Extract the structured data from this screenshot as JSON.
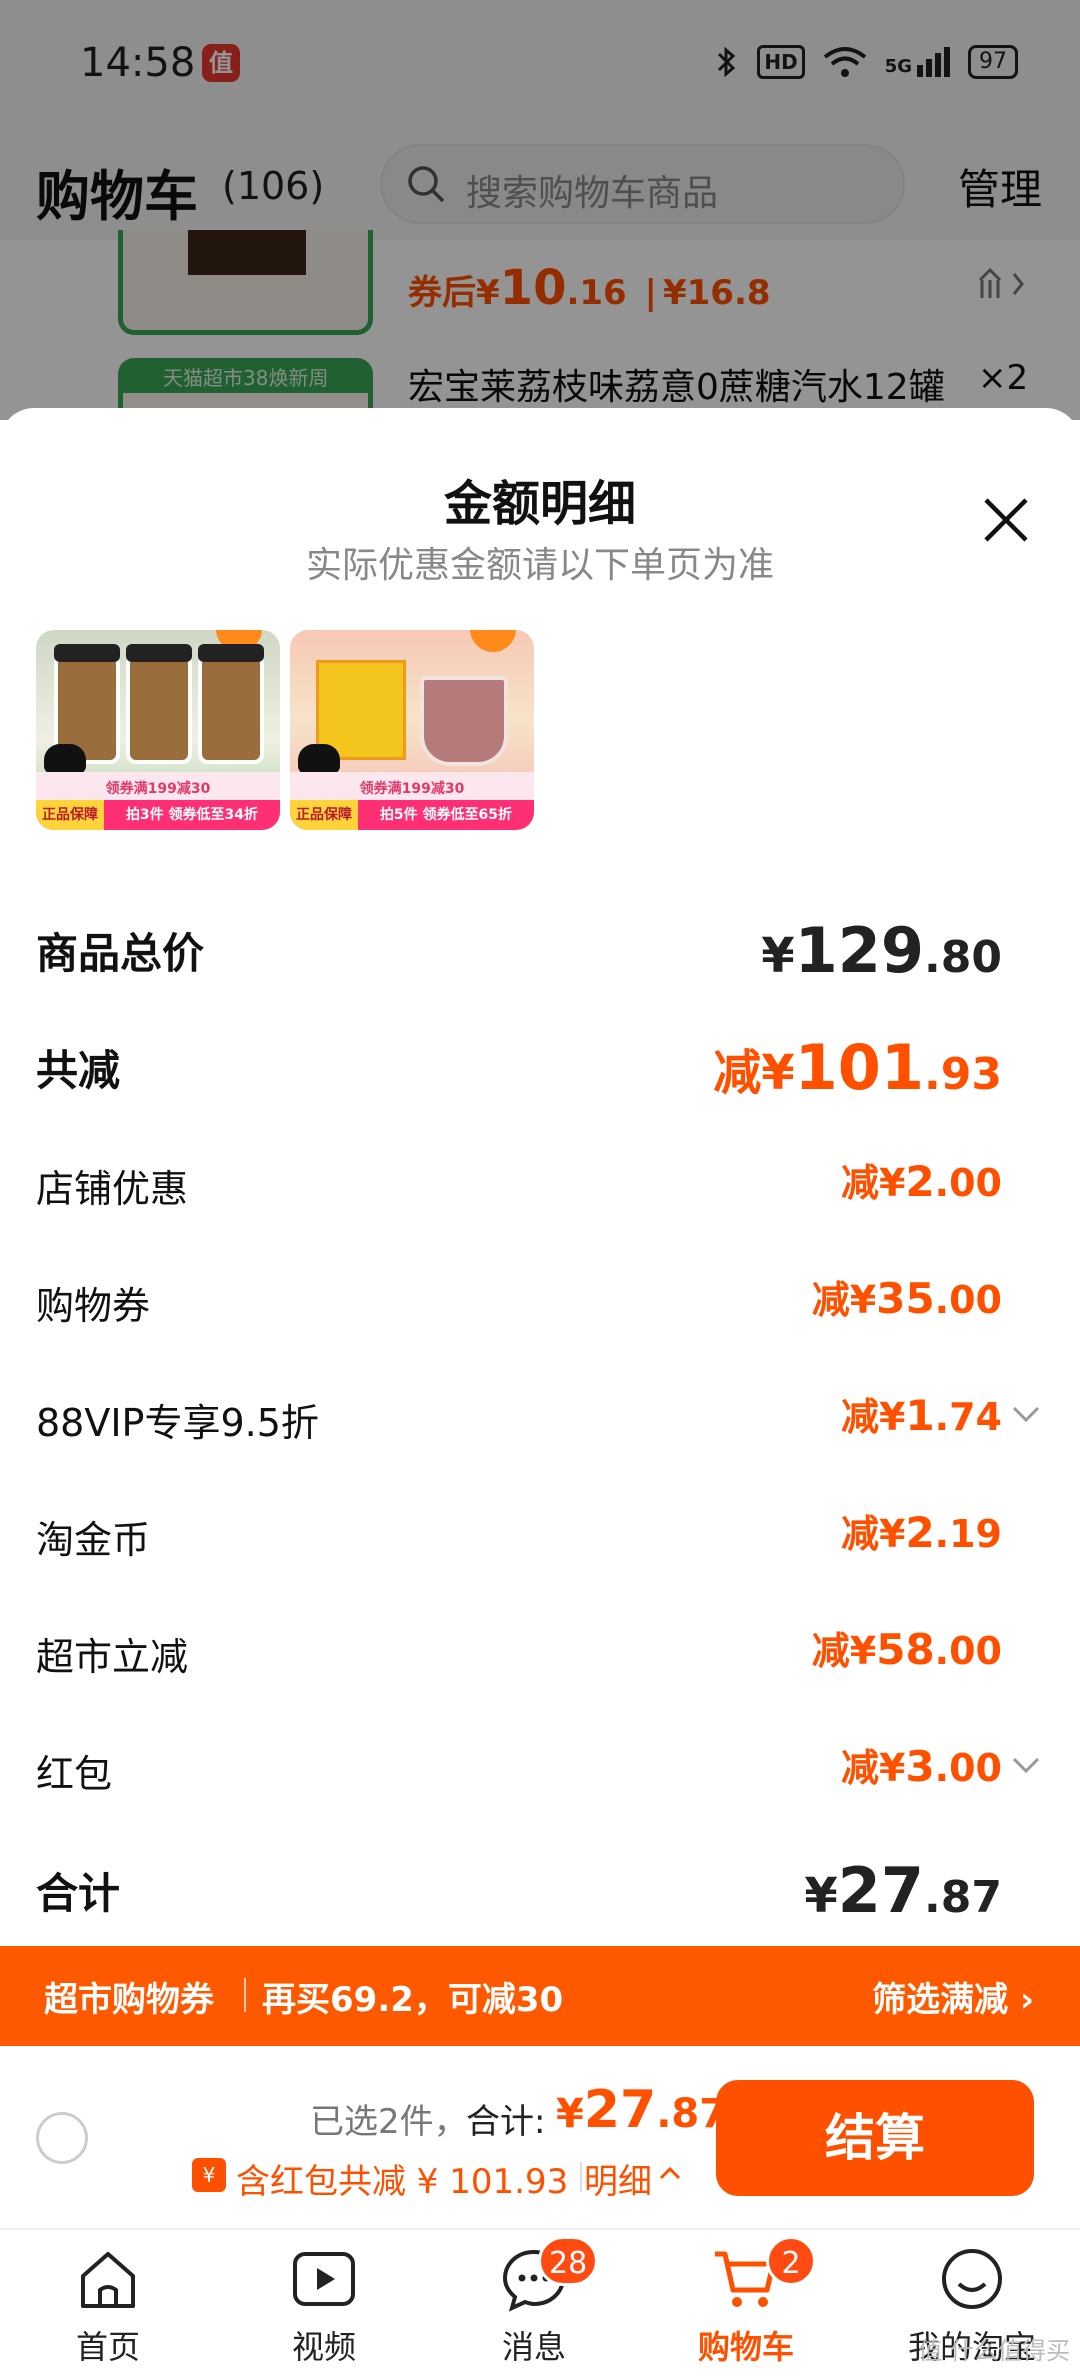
{
  "status_bar": {
    "time": "14:58",
    "app_icon_char": "值",
    "hd": "HD",
    "network": "5G",
    "battery": "97"
  },
  "header": {
    "title": "购物车",
    "count": "(106)",
    "search_placeholder": "搜索购物车商品",
    "manage": "管理"
  },
  "cart_list": {
    "item1": {
      "coupon_prefix": "券后",
      "price_symbol": "¥",
      "price_int": "10",
      "price_dec": ".16",
      "orig_price": "¥16.8"
    },
    "item2": {
      "tag": "天猫超市38焕新周",
      "title": "宏宝莱荔枝味荔意0蔗糖汽水12罐",
      "qty": "×2"
    }
  },
  "sheet": {
    "title": "金额明细",
    "subtitle": "实际优惠金额请以下单页为准",
    "products": [
      {
        "name": "product-mushroom-sauce",
        "tag_main": "领券满199减30",
        "guarantee": "正品保障",
        "promo": "拍3件 领券低至34折"
      },
      {
        "name": "product-drink-powder",
        "tag_main": "领券满199减30",
        "guarantee": "正品保障",
        "promo": "拍5件 领券低至65折"
      }
    ],
    "rows": [
      {
        "key": "total",
        "label": "商品总价",
        "prefix": "",
        "cur": "¥",
        "int": "129",
        "dec": ".80"
      },
      {
        "key": "discount",
        "label": "共减",
        "prefix": "减",
        "cur": "¥",
        "int": "101",
        "dec": ".93"
      },
      {
        "key": "store",
        "label": "店铺优惠",
        "prefix": "减",
        "cur": "¥",
        "int": "2",
        "dec": ".00"
      },
      {
        "key": "coupon",
        "label": "购物券",
        "prefix": "减",
        "cur": "¥",
        "int": "35",
        "dec": ".00"
      },
      {
        "key": "vip",
        "label": "88VIP专享9.5折",
        "prefix": "减",
        "cur": "¥",
        "int": "1",
        "dec": ".74"
      },
      {
        "key": "coins",
        "label": "淘金币",
        "prefix": "减",
        "cur": "¥",
        "int": "2",
        "dec": ".19"
      },
      {
        "key": "market",
        "label": "超市立减",
        "prefix": "减",
        "cur": "¥",
        "int": "58",
        "dec": ".00"
      },
      {
        "key": "redpacket",
        "label": "红包",
        "prefix": "减",
        "cur": "¥",
        "int": "3",
        "dec": ".00"
      },
      {
        "key": "sum",
        "label": "合计",
        "prefix": "",
        "cur": "¥",
        "int": "27",
        "dec": ".87"
      }
    ]
  },
  "banner": {
    "left": "超市购物券",
    "mid": "再买69.2，可减30",
    "right": "筛选满减"
  },
  "checkout": {
    "selected": "已选2件，",
    "total_label": "合计:",
    "total_cur": "¥",
    "total_int": "27",
    "total_dec": ".87",
    "red_icon": "¥",
    "red_text": "含红包共减 ¥ 101.93",
    "detail": "明细",
    "pay": "结算"
  },
  "tabs": [
    {
      "label": "首页"
    },
    {
      "label": "视频"
    },
    {
      "label": "消息",
      "badge": "28"
    },
    {
      "label": "购物车",
      "badge": "2"
    },
    {
      "label": "我的淘宝"
    }
  ],
  "colors": {
    "accent": "#ff5000",
    "tmall_green": "#3aa655"
  },
  "watermark": "值 什么值得买"
}
